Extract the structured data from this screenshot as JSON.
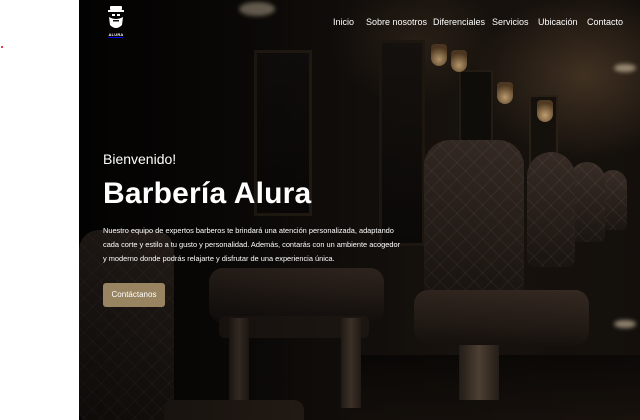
{
  "brand": {
    "logo_text": "ALURA",
    "logo_icon": "bearded-barber-icon"
  },
  "nav": {
    "items": [
      {
        "label": "Inicio"
      },
      {
        "label": "Sobre nosotros"
      },
      {
        "label": "Diferenciales"
      },
      {
        "label": "Servicios"
      },
      {
        "label": "Ubicación"
      },
      {
        "label": "Contacto"
      }
    ]
  },
  "hero": {
    "welcome": "Bienvenido!",
    "title": "Barbería Alura",
    "description": "Nuestro equipo de expertos barberos te brindará una atención personalizada, adaptando cada corte y estilo a tu gusto y personalidad. Además, contarás con un ambiente acogedor y moderno donde podrás relajarte y disfrutar de una experiencia única.",
    "button_label": "Contáctanos"
  },
  "colors": {
    "accent": "#988461",
    "text": "#ffffff",
    "background": "#0d0a08"
  }
}
